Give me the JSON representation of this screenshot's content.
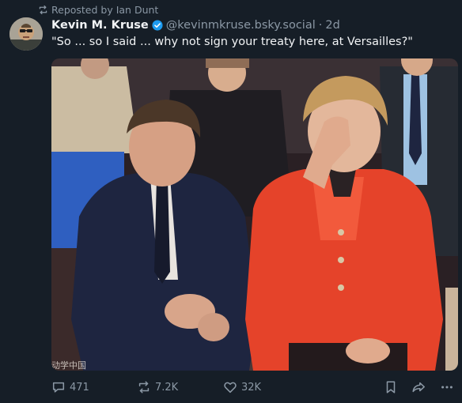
{
  "repost": {
    "icon": "repost-icon",
    "text": "Reposted by Ian Dunt"
  },
  "author": {
    "display_name": "Kevin M. Kruse",
    "verified_icon": "verified-check-icon",
    "handle": "@kevinmkruse.bsky.social",
    "separator": "·",
    "time": "2d"
  },
  "post": {
    "text": "\"So ... so I said ... why not sign your treaty here, at Versailles?\""
  },
  "media": {
    "watermark": "动学中国"
  },
  "actions": {
    "reply": {
      "icon": "reply-icon",
      "count": "471"
    },
    "repost": {
      "icon": "repost-icon",
      "count": "7.2K"
    },
    "like": {
      "icon": "heart-icon",
      "count": "32K"
    },
    "bookmark": {
      "icon": "bookmark-icon"
    },
    "share": {
      "icon": "share-icon"
    },
    "more": {
      "icon": "more-icon"
    }
  },
  "colors": {
    "background": "#161e27",
    "text_primary": "#f1f3f5",
    "text_secondary": "#8b98a5",
    "verified_blue": "#1d9bf0"
  }
}
